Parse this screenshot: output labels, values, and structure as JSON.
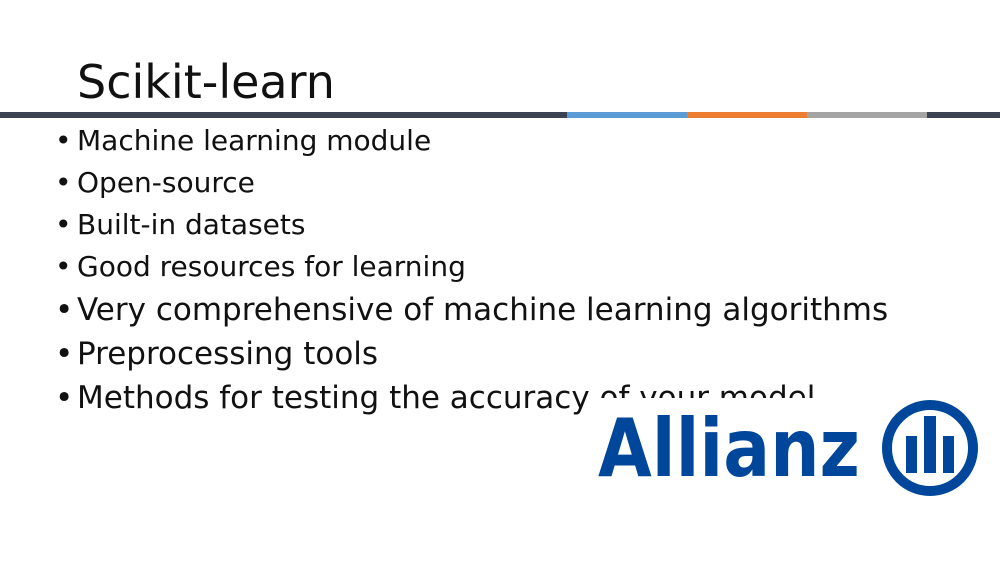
{
  "slide": {
    "title": "Scikit-learn",
    "bullets": [
      "Machine learning module",
      "Open-source",
      "Built-in datasets",
      "Good resources for learning",
      "Very comprehensive of machine learning algorithms",
      "Preprocessing tools",
      "Methods for testing the accuracy of your model"
    ],
    "bullet_glyph": "•"
  },
  "accent_colors": [
    "#3b4254",
    "#5b9bd5",
    "#ed7d31",
    "#a5a5a5",
    "#3b4254"
  ],
  "logo": {
    "wordmark": "Allianz",
    "color": "#00469b"
  }
}
